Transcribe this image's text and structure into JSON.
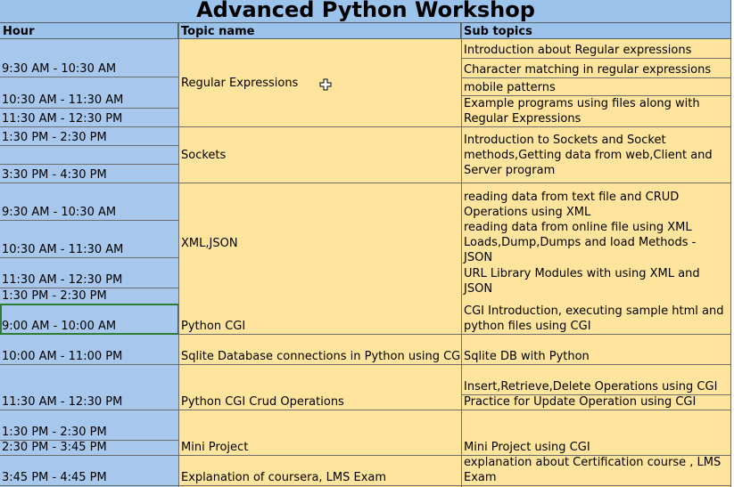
{
  "title": "Advanced Python Workshop",
  "headers": {
    "hour": "Hour",
    "topic": "Topic name",
    "sub": "Sub topics"
  },
  "hours": [
    "9:30 AM - 10:30 AM",
    "10:30 AM - 11:30 AM",
    "11:30 AM - 12:30 PM",
    "1:30 PM - 2:30 PM",
    "3:30 PM - 4:30 PM",
    "9:30 AM - 10:30 AM",
    "10:30 AM - 11:30 AM",
    "11:30 AM - 12:30 PM",
    "1:30 PM - 2:30 PM",
    "9:00 AM - 10:00 AM",
    "10:00 AM - 11:00 PM",
    "11:30 AM - 12:30 PM",
    "1:30 PM - 2:30 PM",
    "2:30 PM - 3:45 PM",
    "3:45 PM - 4:45 PM"
  ],
  "topics": [
    "Regular Expressions",
    "Sockets",
    "XML,JSON",
    "Python CGI",
    "Sqlite Database connections in Python using CGI",
    "Python CGI Crud Operations",
    "Mini Project",
    "Explanation of coursera, LMS Exam"
  ],
  "subtopics": [
    "Introduction about Regular expressions",
    "Character matching in regular expressions",
    "mobile patterns",
    "Example programs using files along with Regular Expressions",
    "Introduction to Sockets and Socket methods,Getting data from web,Client and Server program",
    "reading data from text file and CRUD Operations using XML",
    "reading data from online file using XML Loads,Dump,Dumps and load Methods - JSON",
    "URL Library Modules with using XML and JSON",
    "CGI Introduction, executing sample html and python files using CGI",
    "Sqlite DB with Python",
    "Insert,Retrieve,Delete Operations using CGI",
    "Practice for Update Operation using CGI",
    "Mini Project using CGI",
    "explanation about Certification course , LMS Exam"
  ]
}
